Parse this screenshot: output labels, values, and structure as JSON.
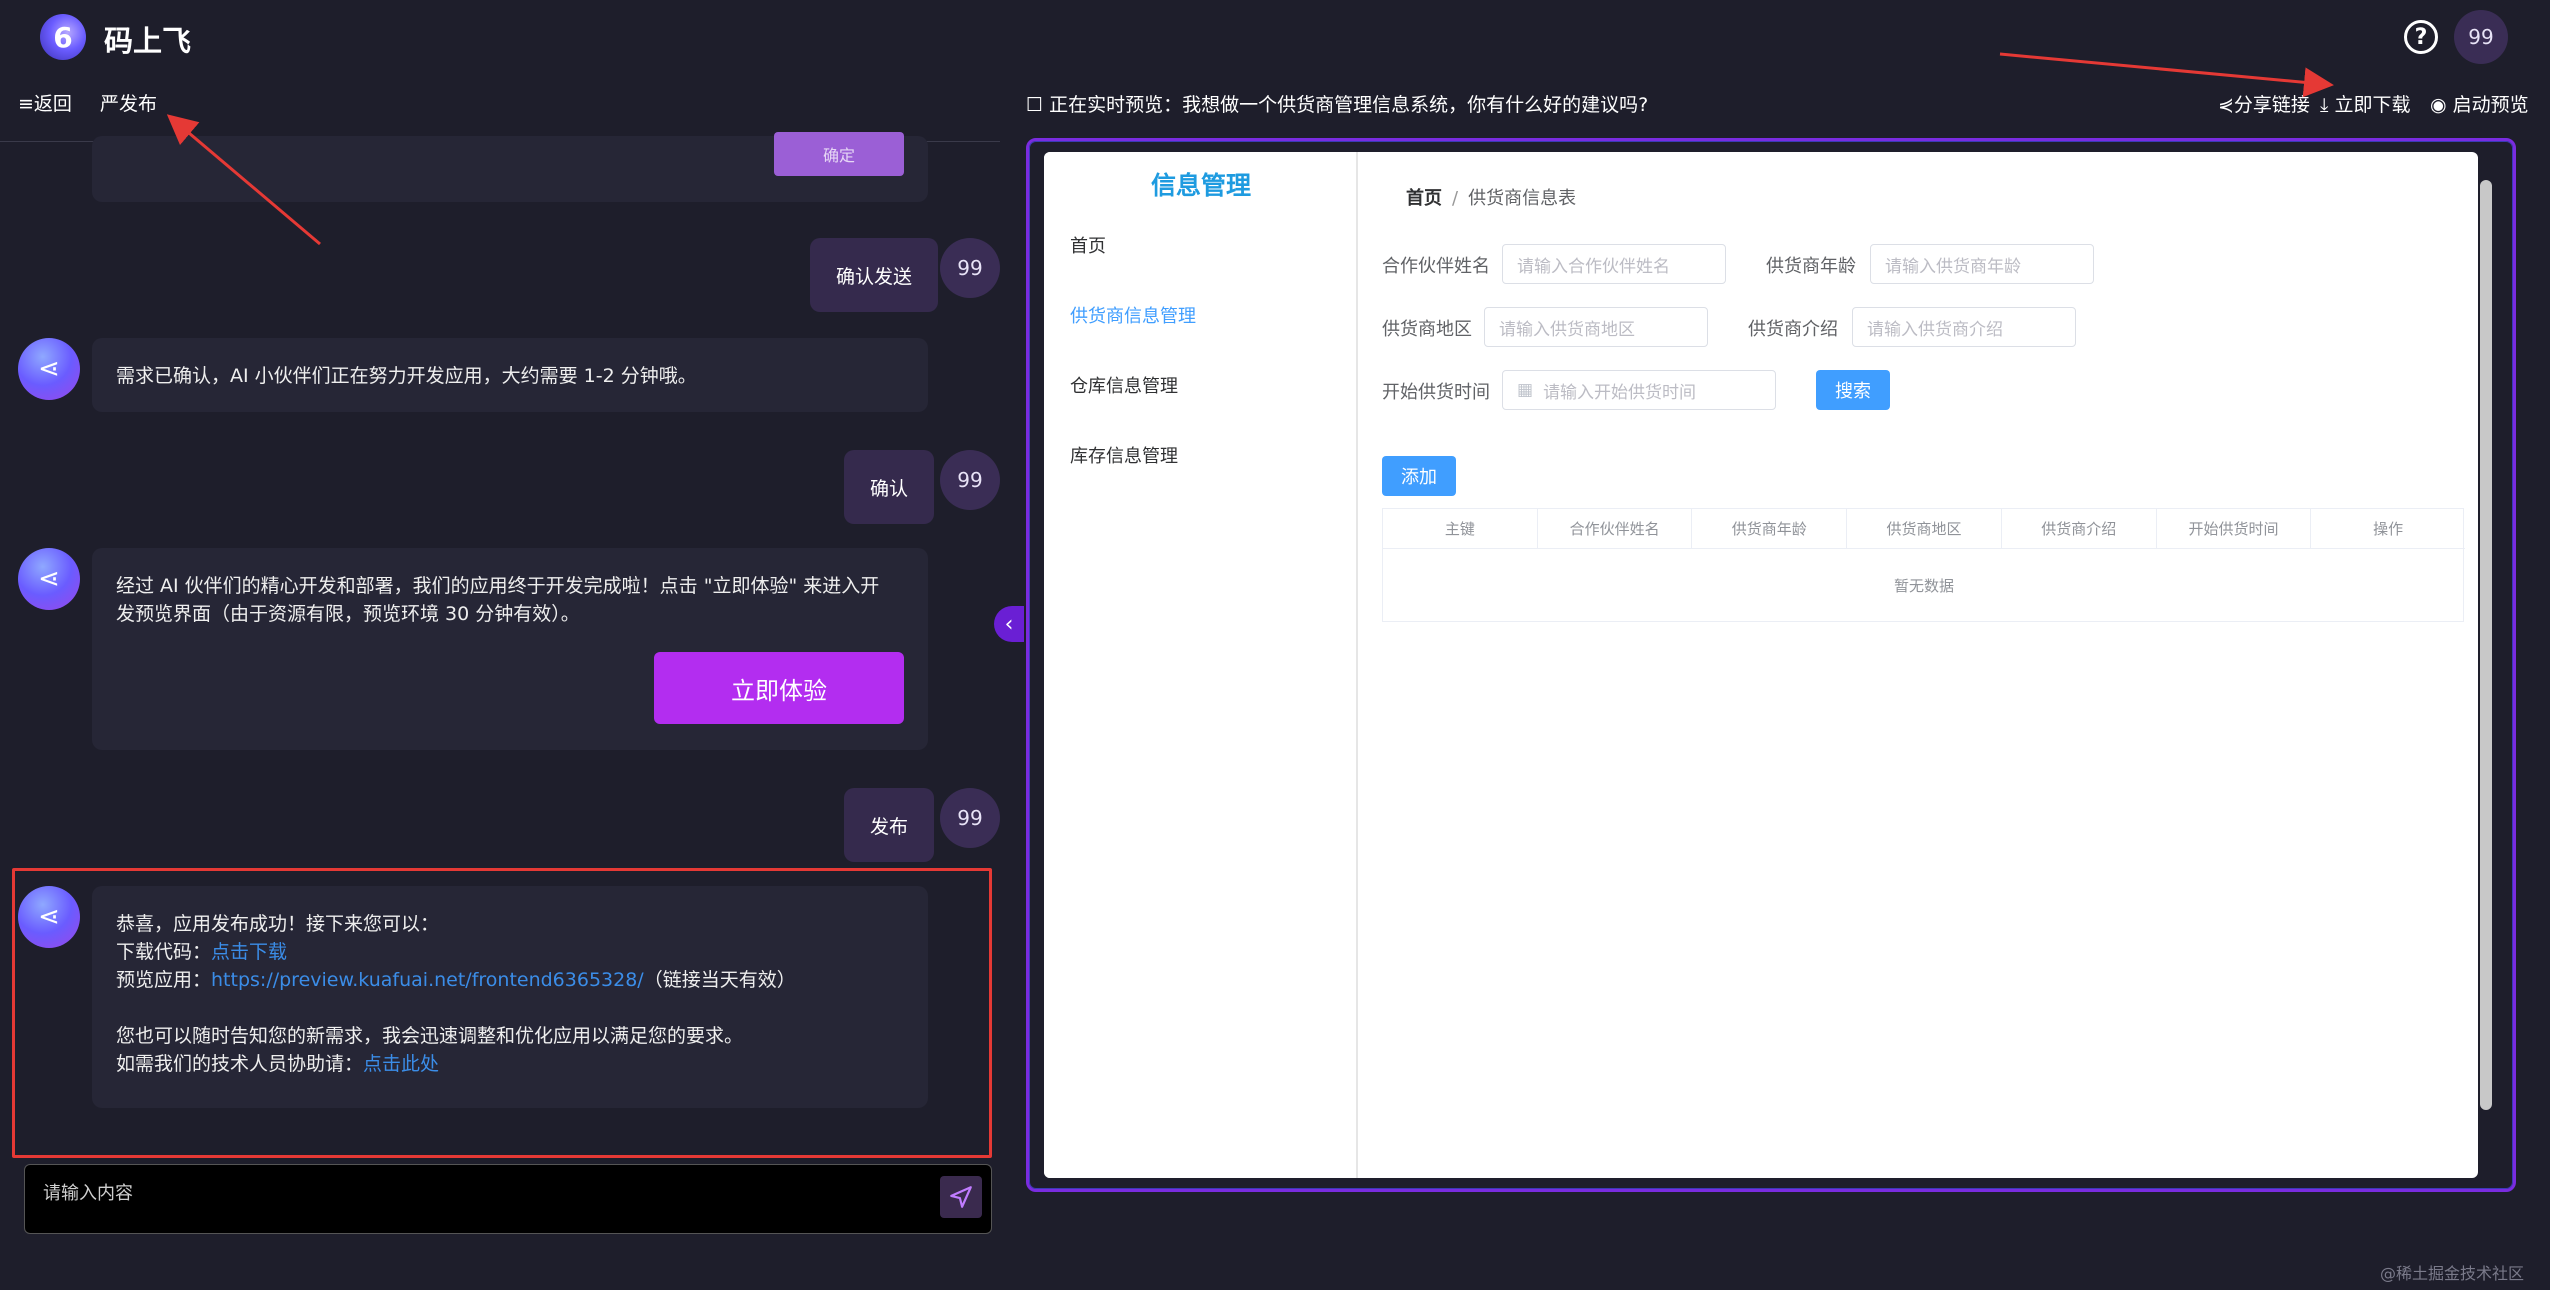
{
  "app": {
    "logo_glyph": "6",
    "title": "码上飞"
  },
  "top": {
    "help_glyph": "?",
    "avatar": "99"
  },
  "nav": {
    "back": "≡返回",
    "publish": "严发布"
  },
  "chat": {
    "confirm_mini": "确定",
    "send_confirm": "确认发送",
    "msg_requirement": "需求已确认，AI 小伙伴们正在努力开发应用，大约需要 1-2 分钟哦。",
    "confirm": "确认",
    "msg_dev_done": "经过 AI 伙伴们的精心开发和部署，我们的应用终于开发完成啦！点击 \"立即体验\" 来进入开发预览界面（由于资源有限，预览环境 30 分钟有效）。",
    "try_now": "立即体验",
    "publish": "发布",
    "success": {
      "line1": "恭喜，应用发布成功！接下来您可以：",
      "download_label": "下载代码：",
      "download_link": "点击下载",
      "preview_label": "预览应用：",
      "preview_link": "https://preview.kuafuai.net/frontend6365328/",
      "preview_note": "（链接当天有效）",
      "line4": "您也可以随时告知您的新需求，我会迅速调整和优化应用以满足您的要求。",
      "help_label": "如需我们的技术人员协助请：",
      "help_link": "点击此处"
    },
    "user_avatar": "99",
    "input_placeholder": "请输入内容"
  },
  "preview": {
    "title": "正在实时预览：我想做一个供货商管理信息系统，你有什么好的建议吗?",
    "share": "分享链接",
    "download": "立即下载",
    "start": "启动预览",
    "app": {
      "menu_title": "信息管理",
      "menu": [
        "首页",
        "供货商信息管理",
        "仓库信息管理",
        "库存信息管理"
      ],
      "crumb_home": "首页",
      "crumb_sep": "/",
      "crumb_current": "供货商信息表",
      "form": {
        "partner_label": "合作伙伴姓名",
        "partner_ph": "请输入合作伙伴姓名",
        "age_label": "供货商年龄",
        "age_ph": "请输入供货商年龄",
        "region_label": "供货商地区",
        "region_ph": "请输入供货商地区",
        "intro_label": "供货商介绍",
        "intro_ph": "请输入供货商介绍",
        "start_label": "开始供货时间",
        "start_ph": "请输入开始供货时间",
        "search": "搜索",
        "add": "添加"
      },
      "table": {
        "headers": [
          "主键",
          "合作伙伴姓名",
          "供货商年龄",
          "供货商地区",
          "供货商介绍",
          "开始供货时间",
          "操作"
        ],
        "empty": "暂无数据"
      }
    }
  },
  "watermark": "@稀土掘金技术社区"
}
